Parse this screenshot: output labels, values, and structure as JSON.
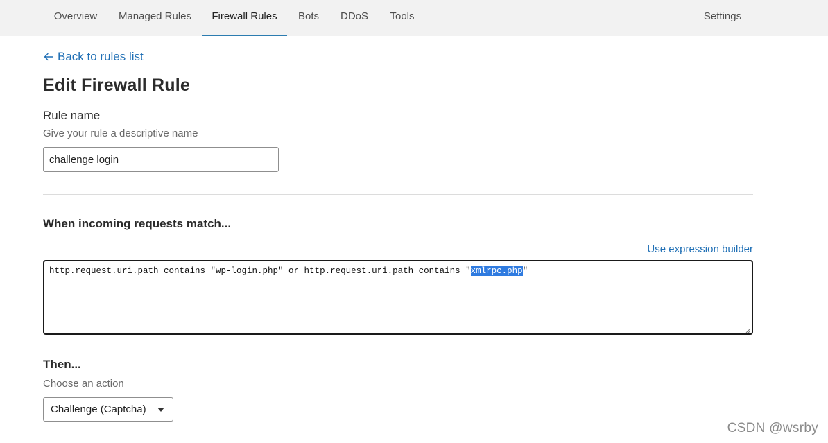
{
  "nav": {
    "tabs": [
      {
        "label": "Overview"
      },
      {
        "label": "Managed Rules"
      },
      {
        "label": "Firewall Rules"
      },
      {
        "label": "Bots"
      },
      {
        "label": "DDoS"
      },
      {
        "label": "Tools"
      }
    ],
    "active_tab": "Firewall Rules",
    "settings_label": "Settings",
    "accent_color": "#2c7cb0"
  },
  "back_link": {
    "label": "Back to rules list",
    "icon": "arrow-left-icon"
  },
  "page_title": "Edit Firewall Rule",
  "rule_name": {
    "label": "Rule name",
    "help": "Give your rule a descriptive name",
    "value": "challenge login"
  },
  "match": {
    "heading": "When incoming requests match...",
    "builder_link": "Use expression builder",
    "expression_before": "http.request.uri.path contains \"wp-login.php\" or http.request.uri.path contains \"",
    "expression_selected": "xmlrpc.php",
    "expression_after": "\""
  },
  "action": {
    "heading": "Then...",
    "help": "Choose an action",
    "selected": "Challenge (Captcha)",
    "icon": "caret-down-icon"
  },
  "watermark": "CSDN @wsrby",
  "colors": {
    "link": "#1f6fb5",
    "selection": "#2f7be0"
  }
}
